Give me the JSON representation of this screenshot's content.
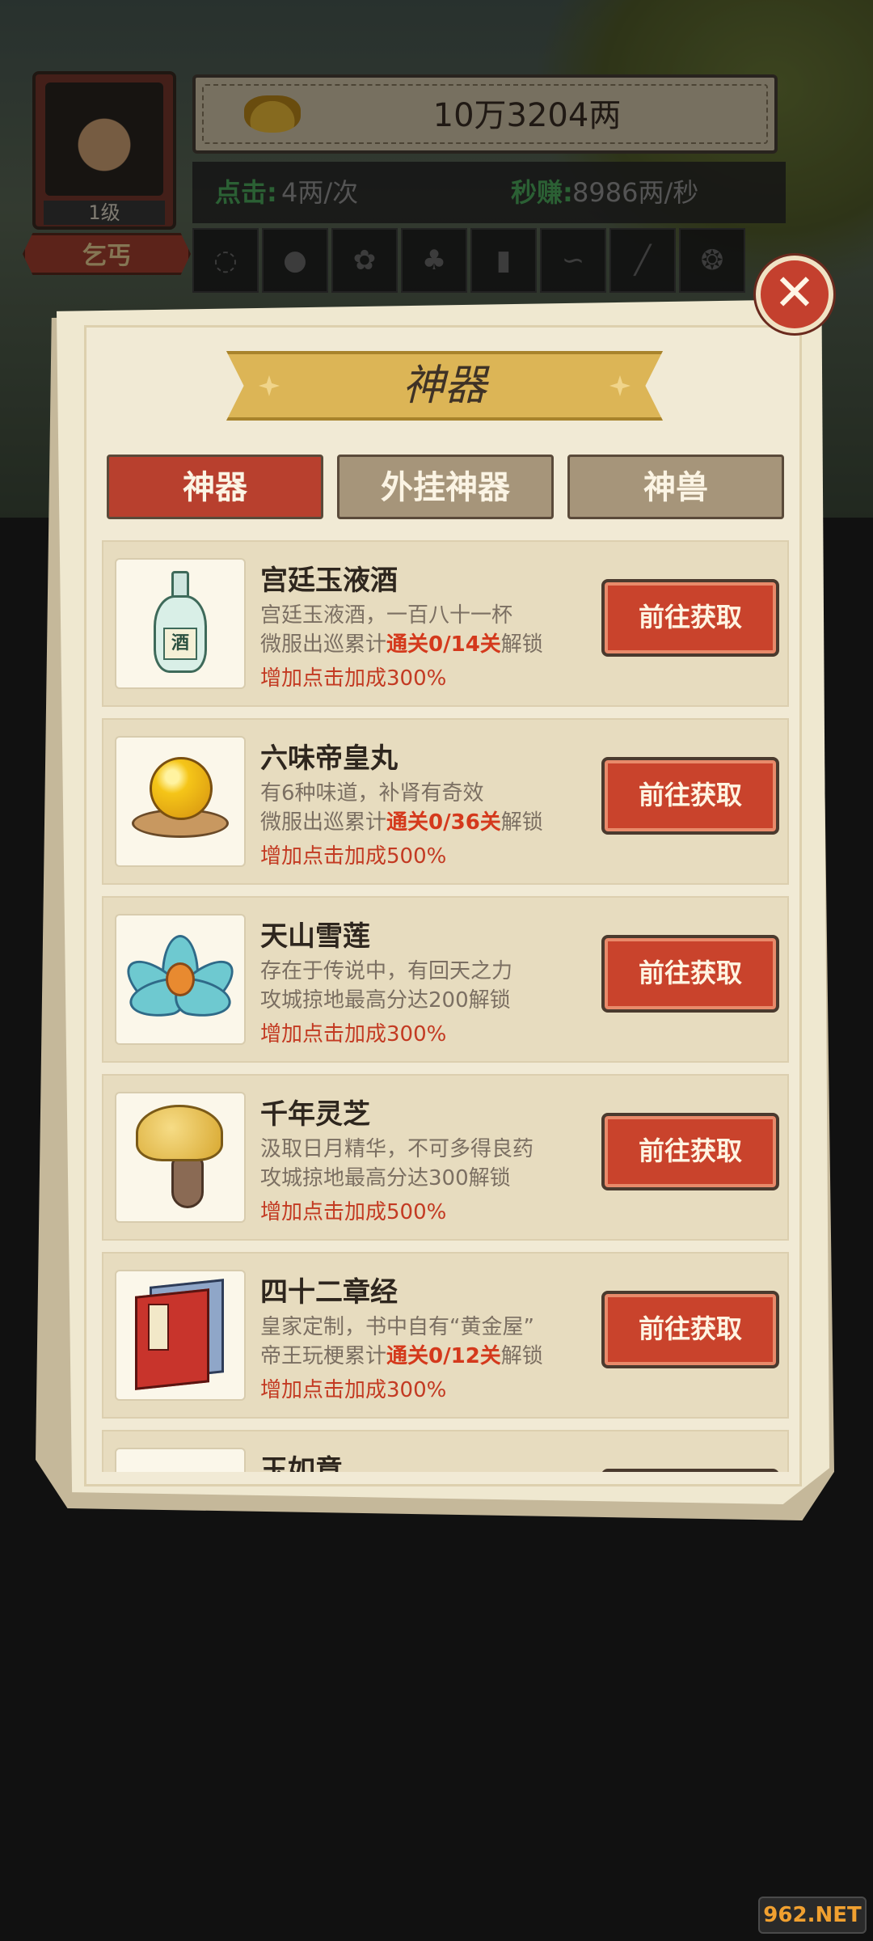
{
  "player": {
    "level": "1级",
    "rank": "乞丐"
  },
  "currency": {
    "amount": "10万3204两",
    "icon": "gold-ingot-icon"
  },
  "rates": {
    "click_label": "点击:",
    "click_value": "4两/次",
    "second_label": "秒赚:",
    "second_value": "8986两/秒"
  },
  "panel": {
    "title": "神器",
    "close_icon": "close-icon"
  },
  "tabs": [
    {
      "label": "神器",
      "active": true
    },
    {
      "label": "外挂神器",
      "active": false
    },
    {
      "label": "神兽",
      "active": false
    }
  ],
  "items": [
    {
      "name": "宫廷玉液酒",
      "desc": "宫廷玉液酒，一百八十一杯",
      "unlock_prefix": "微服出巡累计",
      "unlock_highlight": "通关0/14关",
      "unlock_suffix": "解锁",
      "bonus": "增加点击加成300%",
      "icon": "wine-vase-icon",
      "icon_label": "酒",
      "button": "前往获取"
    },
    {
      "name": "六味帝皇丸",
      "desc": "有6种味道，补肾有奇效",
      "unlock_prefix": "微服出巡累计",
      "unlock_highlight": "通关0/36关",
      "unlock_suffix": "解锁",
      "bonus": "增加点击加成500%",
      "icon": "golden-pill-icon",
      "button": "前往获取"
    },
    {
      "name": "天山雪莲",
      "desc": "存在于传说中，有回天之力",
      "unlock_prefix": "攻城掠地最高分达200解锁",
      "unlock_highlight": "",
      "unlock_suffix": "",
      "bonus": "增加点击加成300%",
      "icon": "snow-lotus-icon",
      "button": "前往获取"
    },
    {
      "name": "千年灵芝",
      "desc": "汲取日月精华，不可多得良药",
      "unlock_prefix": "攻城掠地最高分达300解锁",
      "unlock_highlight": "",
      "unlock_suffix": "",
      "bonus": "增加点击加成500%",
      "icon": "lingzhi-mushroom-icon",
      "button": "前往获取"
    },
    {
      "name": "四十二章经",
      "desc": "皇家定制，书中自有“黄金屋”",
      "unlock_prefix": "帝王玩梗累计",
      "unlock_highlight": "通关0/12关",
      "unlock_suffix": "解锁",
      "bonus": "增加点击加成300%",
      "icon": "scripture-book-icon",
      "button": "前往获取"
    },
    {
      "name": "玉如意",
      "icon": "jade-ruyi-icon"
    }
  ],
  "watermark": "962.NET"
}
